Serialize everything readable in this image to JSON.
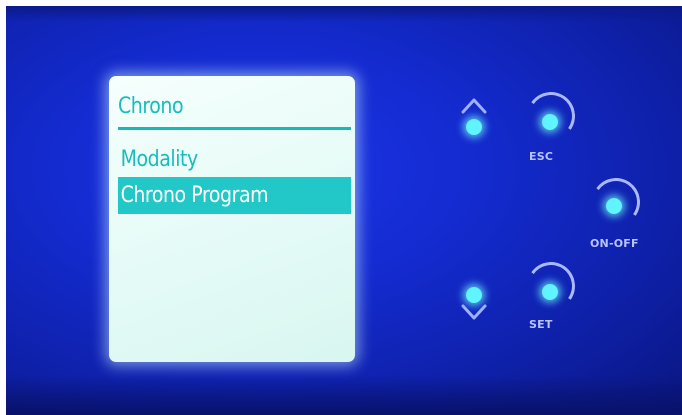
{
  "device": {
    "screen": {
      "title": "Chrono",
      "menu_items": [
        {
          "label": "Modality",
          "selected": false
        },
        {
          "label": "Chrono Program",
          "selected": true
        }
      ]
    },
    "buttons": {
      "up": {
        "icon": "chevron-up-icon"
      },
      "down": {
        "icon": "chevron-down-icon"
      },
      "esc": {
        "label": "ESC"
      },
      "set": {
        "label": "SET"
      },
      "onoff": {
        "label": "ON-OFF"
      }
    },
    "colors": {
      "panel": "#142bd0",
      "lcd_background": "#e6fbf7",
      "lcd_text": "#19bcbc",
      "selection": "#22c7c7",
      "led": "#5ff4ff"
    }
  }
}
